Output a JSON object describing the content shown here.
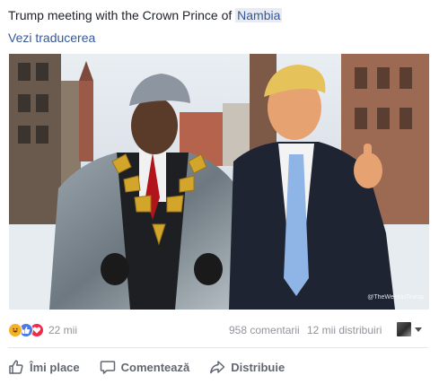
{
  "post": {
    "text_before": "Trump meeting with the Crown Prince of ",
    "tagged": "Nambia",
    "translate_link": "Vezi traducerea"
  },
  "photo": {
    "watermark": "@TheWeekInTrump"
  },
  "stats": {
    "reactions": [
      "haha",
      "like",
      "love"
    ],
    "reaction_count": "22 mii",
    "comments": "958 comentarii",
    "shares": "12 mii distribuiri"
  },
  "actions": {
    "like": "Îmi place",
    "comment": "Comentează",
    "share": "Distribuie"
  },
  "colors": {
    "link": "#365899",
    "meta_text": "#90949c",
    "action_text": "#606770",
    "haha": "#f7b125",
    "like": "#4b7ae6",
    "love": "#f0284a"
  }
}
